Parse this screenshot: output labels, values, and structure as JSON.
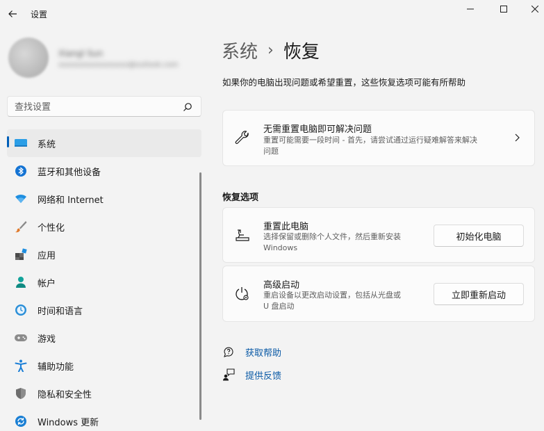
{
  "window": {
    "title": "设置",
    "controls": {
      "minimize": "minimize-icon",
      "maximize": "maximize-icon",
      "close": "close-icon"
    }
  },
  "profile": {
    "name": "Xiangl Sun",
    "email": "xxxxxxxxxxxxxxxxx@outlook.com"
  },
  "search": {
    "placeholder": "查找设置",
    "value": ""
  },
  "nav": {
    "items": [
      {
        "label": "系统",
        "icon": "system-icon",
        "active": true
      },
      {
        "label": "蓝牙和其他设备",
        "icon": "bluetooth-icon"
      },
      {
        "label": "网络和 Internet",
        "icon": "wifi-icon"
      },
      {
        "label": "个性化",
        "icon": "brush-icon"
      },
      {
        "label": "应用",
        "icon": "apps-icon"
      },
      {
        "label": "帐户",
        "icon": "account-icon"
      },
      {
        "label": "时间和语言",
        "icon": "time-language-icon"
      },
      {
        "label": "游戏",
        "icon": "gamepad-icon"
      },
      {
        "label": "辅助功能",
        "icon": "accessibility-icon"
      },
      {
        "label": "隐私和安全性",
        "icon": "shield-icon"
      },
      {
        "label": "Windows 更新",
        "icon": "update-icon"
      }
    ]
  },
  "main": {
    "breadcrumb": {
      "parent": "系统",
      "separator": "›",
      "current": "恢复"
    },
    "description": "如果你的电脑出现问题或希望重置，这些恢复选项可能有所帮助",
    "troubleshoot": {
      "title": "无需重置电脑即可解决问题",
      "subtitle_line1": "重置可能需要一段时间 - 首先，请尝试通过运行疑难解答来解决",
      "subtitle_line2": "问题"
    },
    "recovery_section_title": "恢复选项",
    "reset": {
      "title": "重置此电脑",
      "subtitle_line1": "选择保留或删除个人文件，然后重新安装",
      "subtitle_line2": "Windows",
      "button": "初始化电脑"
    },
    "advanced": {
      "title": "高级启动",
      "subtitle_line1": "重启设备以更改启动设置，包括从光盘或",
      "subtitle_line2": "U 盘启动",
      "button": "立即重新启动"
    },
    "links": {
      "help": "获取帮助",
      "feedback": "提供反馈"
    }
  },
  "colors": {
    "accent": "#005fb8",
    "link": "#0a5aa6",
    "background": "#f3f3f3",
    "card": "#fbfbfb"
  }
}
